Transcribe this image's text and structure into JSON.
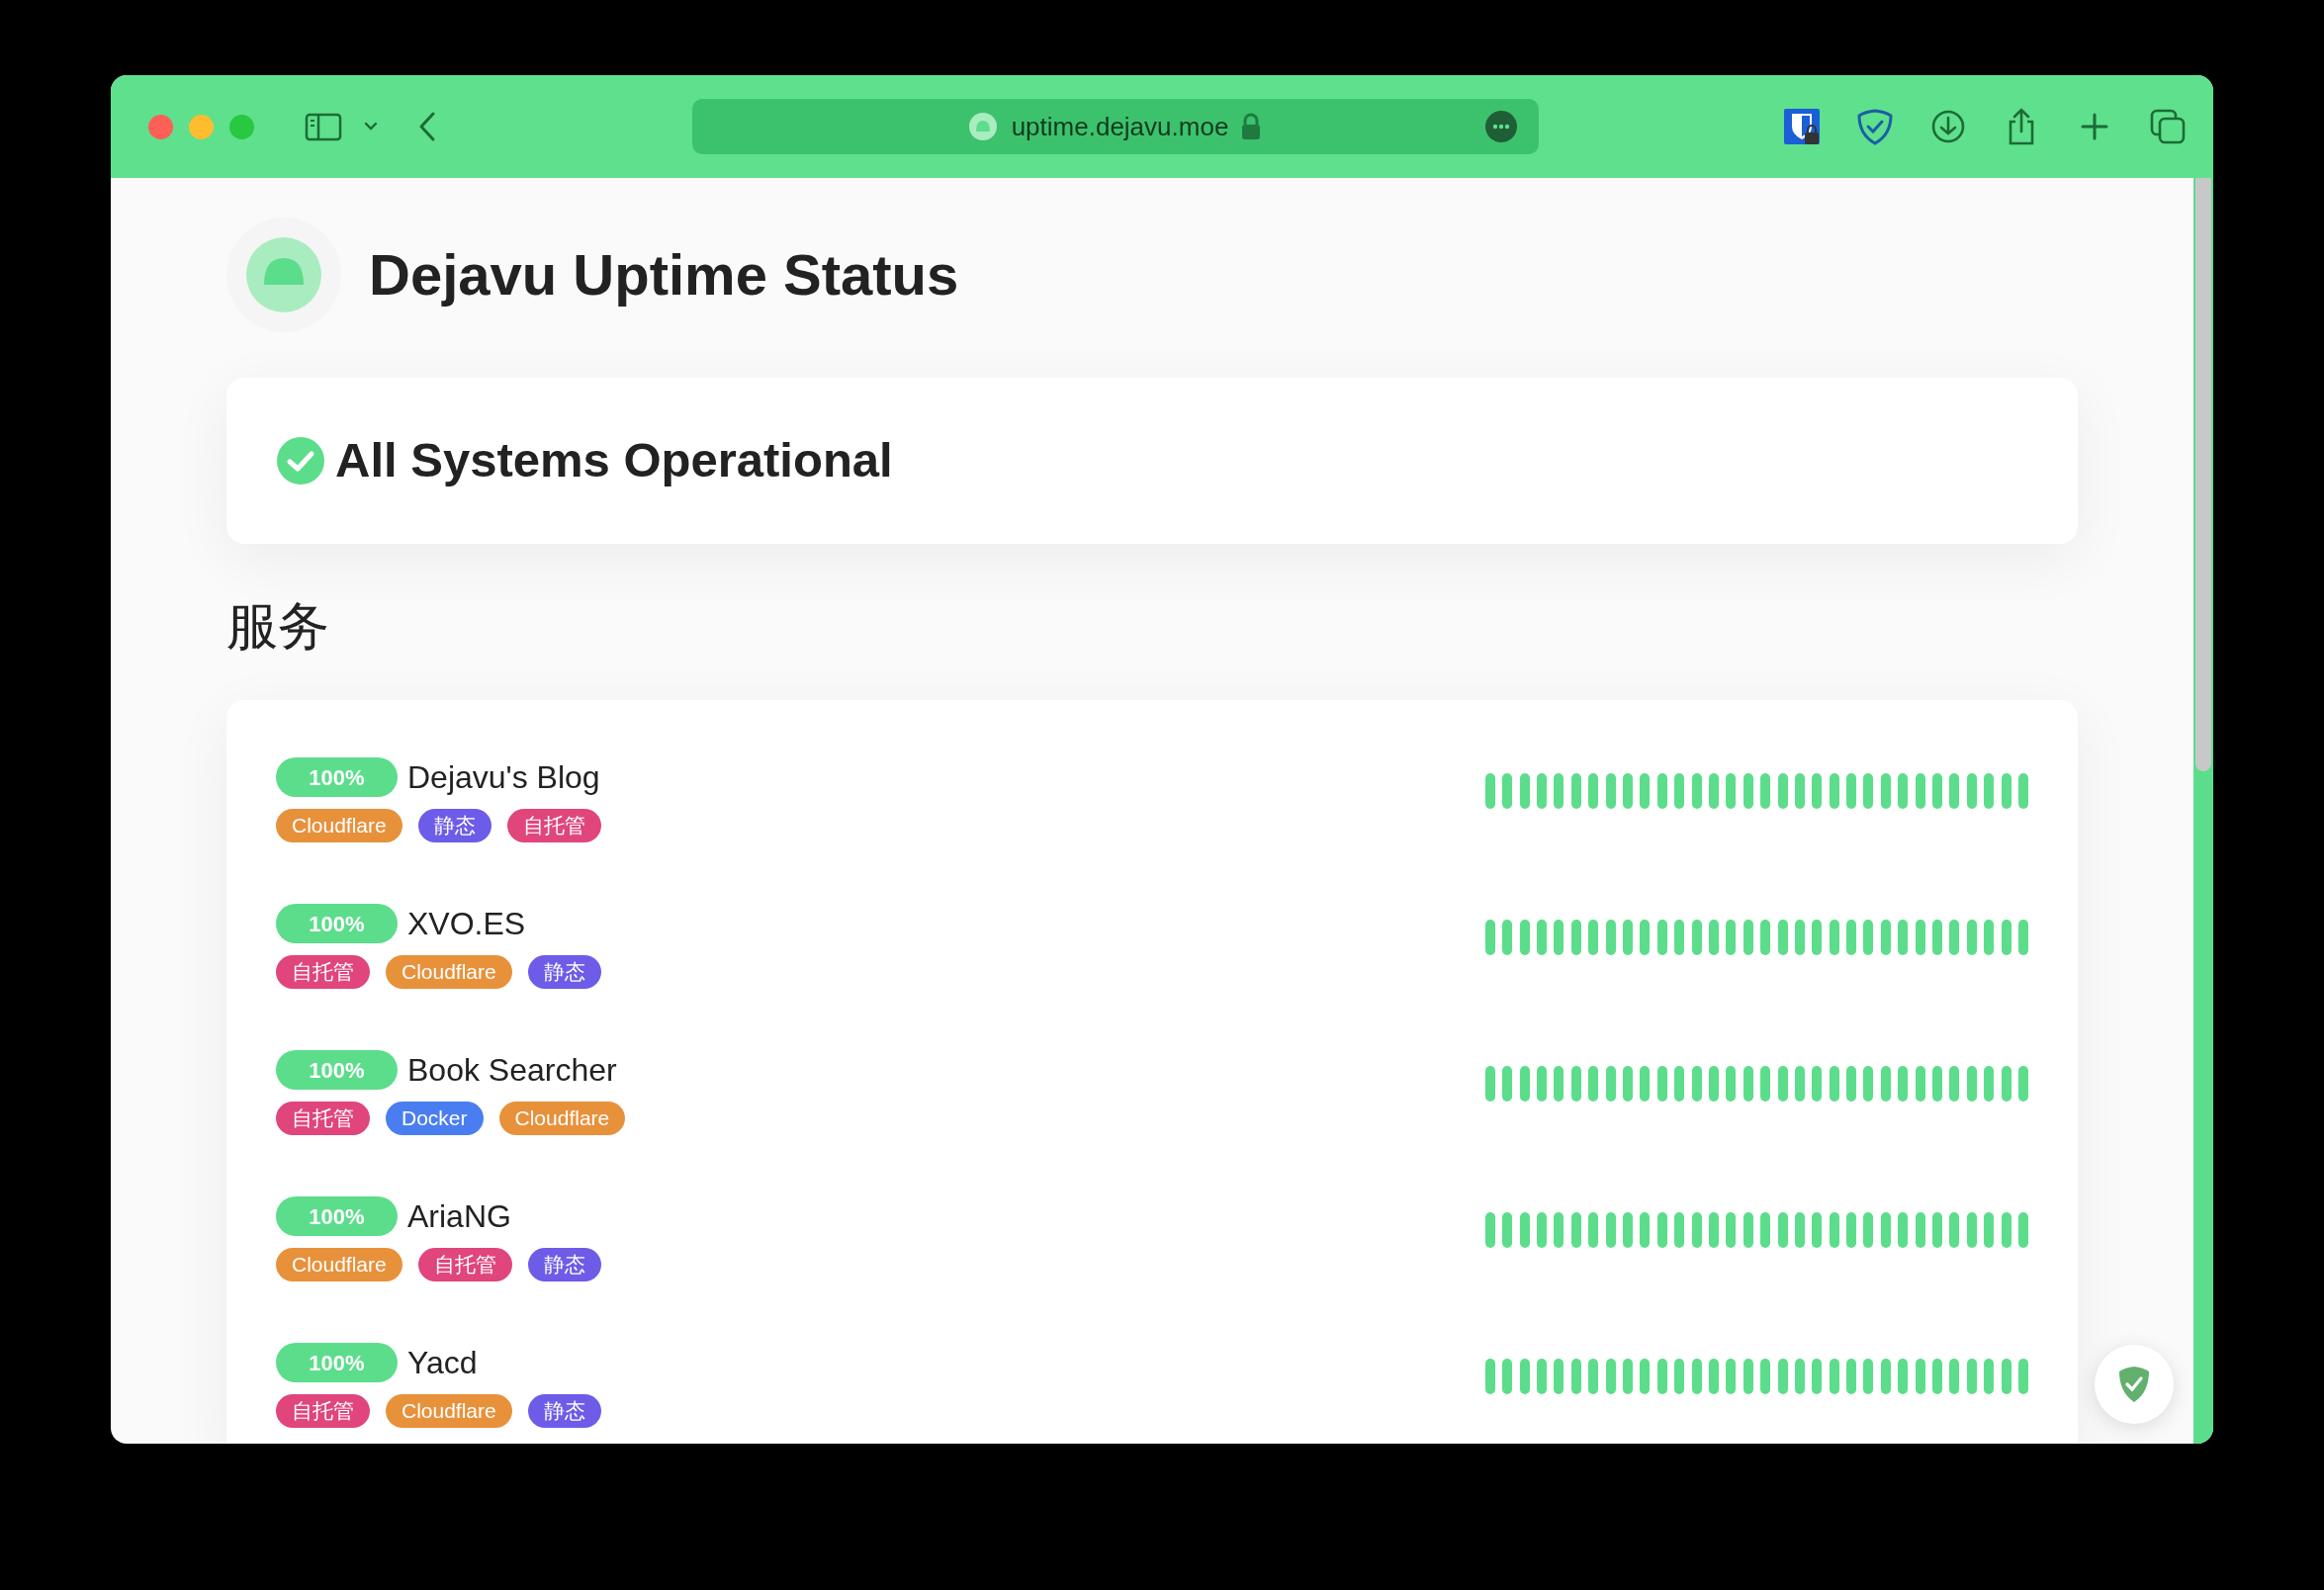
{
  "browser": {
    "url": "uptime.dejavu.moe"
  },
  "page": {
    "title": "Dejavu Uptime Status",
    "status": {
      "text": "All Systems Operational",
      "operational": true
    },
    "section_title": "服务"
  },
  "services": [
    {
      "uptime": "100%",
      "name": "Dejavu's Blog",
      "tags": [
        {
          "label": "Cloudflare",
          "color": "#e8913b"
        },
        {
          "label": "静态",
          "color": "#6c5ce7"
        },
        {
          "label": "自托管",
          "color": "#e0457b"
        }
      ],
      "beats": [
        {
          "up": true
        },
        {
          "up": true
        },
        {
          "up": true
        },
        {
          "up": true
        },
        {
          "up": true
        },
        {
          "up": true
        },
        {
          "up": true
        },
        {
          "up": true
        },
        {
          "up": true
        },
        {
          "up": true
        },
        {
          "up": true
        },
        {
          "up": true
        },
        {
          "up": true
        },
        {
          "up": true
        },
        {
          "up": true
        },
        {
          "up": true
        },
        {
          "up": true
        },
        {
          "up": true
        },
        {
          "up": true
        },
        {
          "up": true
        },
        {
          "up": true
        },
        {
          "up": true
        },
        {
          "up": true
        },
        {
          "up": true
        },
        {
          "up": true
        },
        {
          "up": true
        },
        {
          "up": true
        },
        {
          "up": true
        },
        {
          "up": true
        },
        {
          "up": true
        },
        {
          "up": true
        },
        {
          "up": true
        }
      ]
    },
    {
      "uptime": "100%",
      "name": "XVO.ES",
      "tags": [
        {
          "label": "自托管",
          "color": "#e0457b"
        },
        {
          "label": "Cloudflare",
          "color": "#e8913b"
        },
        {
          "label": "静态",
          "color": "#6c5ce7"
        }
      ],
      "beats": [
        {
          "up": true
        },
        {
          "up": true
        },
        {
          "up": true
        },
        {
          "up": true
        },
        {
          "up": true
        },
        {
          "up": true
        },
        {
          "up": true
        },
        {
          "up": true
        },
        {
          "up": true
        },
        {
          "up": true
        },
        {
          "up": true
        },
        {
          "up": true
        },
        {
          "up": true
        },
        {
          "up": true
        },
        {
          "up": true
        },
        {
          "up": true
        },
        {
          "up": true
        },
        {
          "up": true
        },
        {
          "up": true
        },
        {
          "up": true
        },
        {
          "up": true
        },
        {
          "up": true
        },
        {
          "up": true
        },
        {
          "up": true
        },
        {
          "up": true
        },
        {
          "up": true
        },
        {
          "up": true
        },
        {
          "up": true
        },
        {
          "up": true
        },
        {
          "up": true
        },
        {
          "up": true
        },
        {
          "up": true
        }
      ]
    },
    {
      "uptime": "100%",
      "name": "Book Searcher",
      "tags": [
        {
          "label": "自托管",
          "color": "#e0457b"
        },
        {
          "label": "Docker",
          "color": "#4a7ef0"
        },
        {
          "label": "Cloudflare",
          "color": "#e8913b"
        }
      ],
      "beats": [
        {
          "up": true
        },
        {
          "up": true
        },
        {
          "up": true
        },
        {
          "up": true
        },
        {
          "up": true
        },
        {
          "up": true
        },
        {
          "up": true
        },
        {
          "up": true
        },
        {
          "up": true
        },
        {
          "up": true
        },
        {
          "up": true
        },
        {
          "up": true
        },
        {
          "up": true
        },
        {
          "up": true
        },
        {
          "up": true
        },
        {
          "up": true
        },
        {
          "up": true
        },
        {
          "up": true
        },
        {
          "up": true
        },
        {
          "up": true
        },
        {
          "up": true
        },
        {
          "up": true
        },
        {
          "up": true
        },
        {
          "up": true
        },
        {
          "up": true
        },
        {
          "up": true
        },
        {
          "up": true
        },
        {
          "up": true
        },
        {
          "up": true
        },
        {
          "up": true
        },
        {
          "up": true
        },
        {
          "up": true
        }
      ]
    },
    {
      "uptime": "100%",
      "name": "AriaNG",
      "tags": [
        {
          "label": "Cloudflare",
          "color": "#e8913b"
        },
        {
          "label": "自托管",
          "color": "#e0457b"
        },
        {
          "label": "静态",
          "color": "#6c5ce7"
        }
      ],
      "beats": [
        {
          "up": true
        },
        {
          "up": true
        },
        {
          "up": true
        },
        {
          "up": true
        },
        {
          "up": true
        },
        {
          "up": true
        },
        {
          "up": true
        },
        {
          "up": true
        },
        {
          "up": true
        },
        {
          "up": true
        },
        {
          "up": true
        },
        {
          "up": true
        },
        {
          "up": true
        },
        {
          "up": true
        },
        {
          "up": true
        },
        {
          "up": true
        },
        {
          "up": true
        },
        {
          "up": true
        },
        {
          "up": true
        },
        {
          "up": true
        },
        {
          "up": true
        },
        {
          "up": true
        },
        {
          "up": true
        },
        {
          "up": true
        },
        {
          "up": true
        },
        {
          "up": true
        },
        {
          "up": true
        },
        {
          "up": true
        },
        {
          "up": true
        },
        {
          "up": true
        },
        {
          "up": true
        },
        {
          "up": true
        }
      ]
    },
    {
      "uptime": "100%",
      "name": "Yacd",
      "tags": [
        {
          "label": "自托管",
          "color": "#e0457b"
        },
        {
          "label": "Cloudflare",
          "color": "#e8913b"
        },
        {
          "label": "静态",
          "color": "#6c5ce7"
        }
      ],
      "beats": [
        {
          "up": true
        },
        {
          "up": true
        },
        {
          "up": true
        },
        {
          "up": true
        },
        {
          "up": true
        },
        {
          "up": true
        },
        {
          "up": true
        },
        {
          "up": true
        },
        {
          "up": true
        },
        {
          "up": true
        },
        {
          "up": true
        },
        {
          "up": true
        },
        {
          "up": true
        },
        {
          "up": true
        },
        {
          "up": true
        },
        {
          "up": true
        },
        {
          "up": true
        },
        {
          "up": true
        },
        {
          "up": true
        },
        {
          "up": true
        },
        {
          "up": true
        },
        {
          "up": true
        },
        {
          "up": true
        },
        {
          "up": true
        },
        {
          "up": true
        },
        {
          "up": true
        },
        {
          "up": true
        },
        {
          "up": true
        },
        {
          "up": true
        },
        {
          "up": true
        },
        {
          "up": true
        },
        {
          "up": true
        }
      ]
    }
  ]
}
